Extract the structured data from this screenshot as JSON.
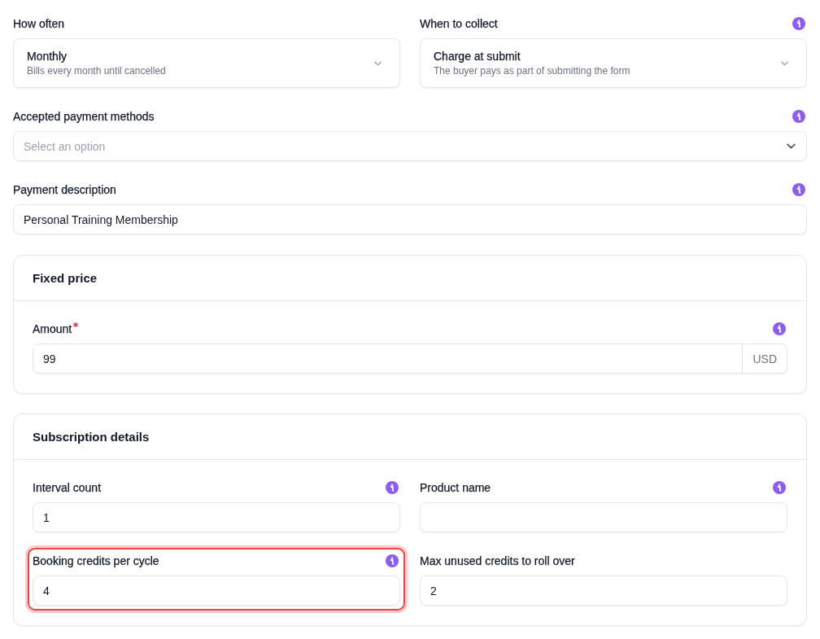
{
  "rows": [
    [
      {
        "kind": "rich-select",
        "label": "How often",
        "required": false,
        "info": false,
        "highlighted": false,
        "value": "Monthly",
        "description": "Bills every month until cancelled"
      },
      {
        "kind": "rich-select",
        "label": "When to collect",
        "required": false,
        "info": true,
        "highlighted": false,
        "value": "Charge at submit",
        "description": "The buyer pays as part of submitting the form"
      }
    ],
    [
      {
        "kind": "select",
        "label": "Accepted payment methods",
        "required": false,
        "info": true,
        "highlighted": false,
        "placeholder": "Select an option"
      }
    ],
    [
      {
        "kind": "text",
        "label": "Payment description",
        "required": false,
        "info": true,
        "highlighted": false,
        "value": "Personal Training Membership"
      }
    ]
  ],
  "sections": [
    {
      "title": "Fixed price",
      "rows": [
        [
          {
            "kind": "currency",
            "label": "Amount",
            "required": true,
            "info": true,
            "highlighted": false,
            "value": "99",
            "currency": "USD"
          }
        ]
      ]
    },
    {
      "title": "Subscription details",
      "rows": [
        [
          {
            "kind": "text",
            "label": "Interval count",
            "required": false,
            "info": true,
            "highlighted": false,
            "value": "1"
          },
          {
            "kind": "text",
            "label": "Product name",
            "required": false,
            "info": true,
            "highlighted": false
          }
        ],
        [
          {
            "kind": "text",
            "label": "Booking credits per cycle",
            "required": false,
            "info": true,
            "highlighted": true,
            "value": "4"
          },
          {
            "kind": "text",
            "label": "Max unused credits to roll over",
            "required": false,
            "info": false,
            "highlighted": false,
            "value": "2"
          }
        ]
      ]
    }
  ]
}
